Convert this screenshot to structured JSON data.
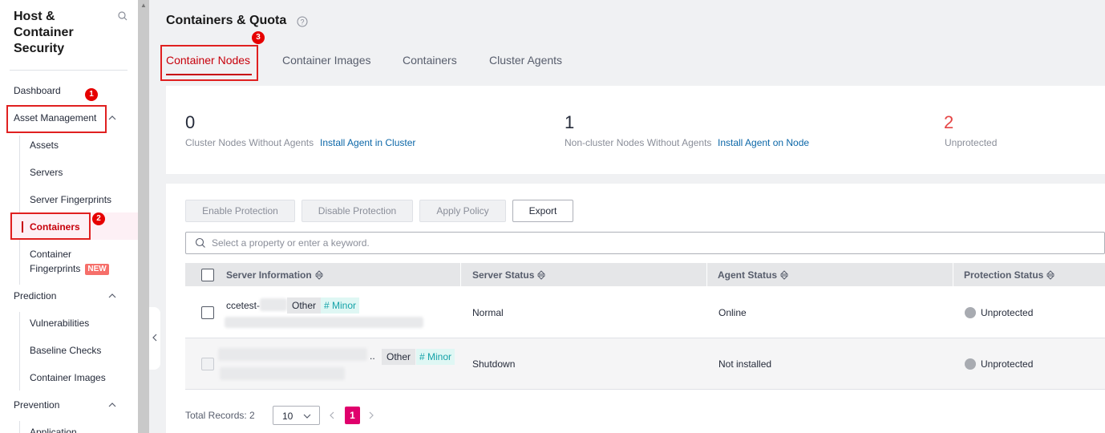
{
  "sidebar": {
    "title": "Host & Container Security",
    "items": {
      "dashboard": "Dashboard",
      "asset_management": "Asset Management",
      "assets": "Assets",
      "servers": "Servers",
      "server_fingerprints": "Server Fingerprints",
      "containers": "Containers",
      "container_fingerprints": "Container Fingerprints",
      "new_badge": "NEW",
      "prediction": "Prediction",
      "vulnerabilities": "Vulnerabilities",
      "baseline_checks": "Baseline Checks",
      "container_images": "Container Images",
      "prevention": "Prevention",
      "application": "Application"
    }
  },
  "markers": [
    "1",
    "2",
    "3"
  ],
  "page": {
    "title": "Containers & Quota",
    "tabs": [
      {
        "label": "Container Nodes",
        "active": true
      },
      {
        "label": "Container Images",
        "active": false
      },
      {
        "label": "Containers",
        "active": false
      },
      {
        "label": "Cluster Agents",
        "active": false
      }
    ]
  },
  "summary": [
    {
      "value": "0",
      "label": "Cluster Nodes Without Agents",
      "link": "Install Agent in Cluster"
    },
    {
      "value": "1",
      "label": "Non-cluster Nodes Without Agents",
      "link": "Install Agent on Node"
    },
    {
      "value": "2",
      "label": "Unprotected",
      "link": ""
    }
  ],
  "toolbar": {
    "enable": "Enable Protection",
    "disable": "Disable Protection",
    "apply_policy": "Apply Policy",
    "export": "Export"
  },
  "search": {
    "placeholder": "Select a property or enter a keyword."
  },
  "table": {
    "headers": [
      "Server Information",
      "Server Status",
      "Agent Status",
      "Protection Status"
    ],
    "rows": [
      {
        "name": "ccetest-",
        "tag_other": "Other",
        "tag_minor": "# Minor",
        "server_status": "Normal",
        "agent_status": "Online",
        "protection_status": "Unprotected"
      },
      {
        "name": "..",
        "tag_other": "Other",
        "tag_minor": "# Minor",
        "server_status": "Shutdown",
        "agent_status": "Not installed",
        "protection_status": "Unprotected"
      }
    ]
  },
  "pagination": {
    "total": "Total Records: 2",
    "page_size": "10",
    "current_page": "1"
  },
  "colors": {
    "accent": "#c7000b",
    "pager_active": "#e0006c",
    "link": "#0c67a8",
    "annotation": "#e02020"
  }
}
